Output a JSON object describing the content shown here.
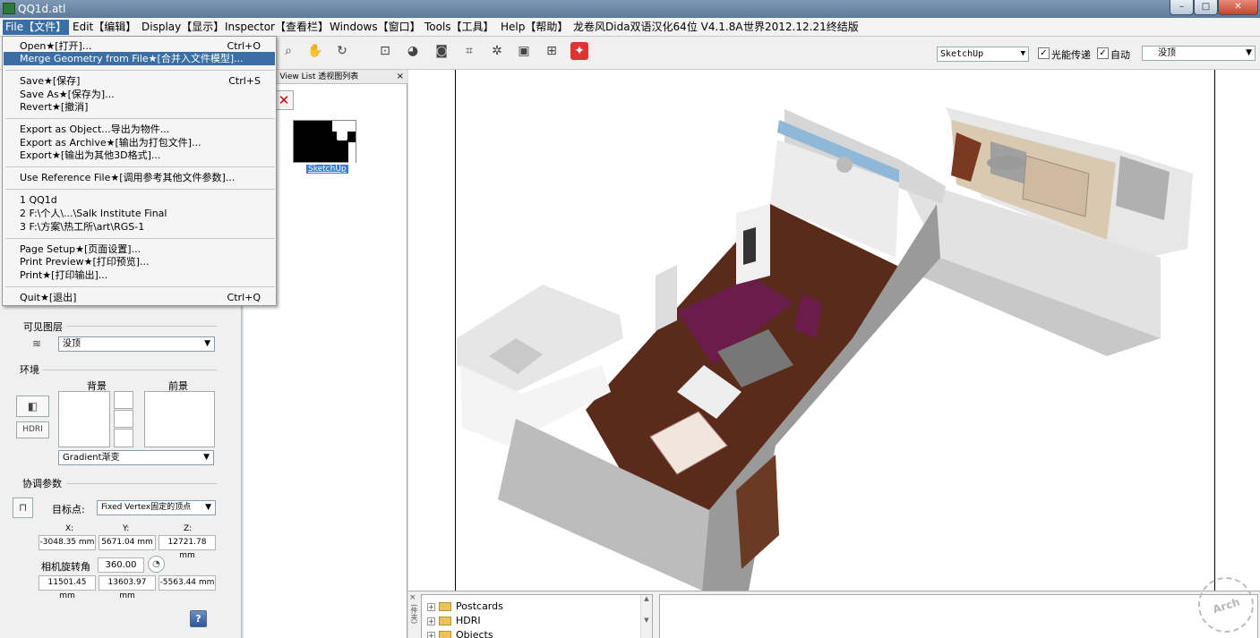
{
  "window": {
    "title": "QQ1d.atl",
    "minimize_glyph": "–",
    "maximize_glyph": "□",
    "close_glyph": "✕"
  },
  "menubar": [
    "File【文件】",
    "Edit【编辑】",
    "Display【显示】",
    "Inspector【查看栏】",
    "Windows【窗口】",
    "Tools【工具】",
    "Help【帮助】",
    "龙卷风Dida双语汉化64位 V4.1.8A",
    "世界2012.12.21终结版"
  ],
  "file_menu": {
    "items": [
      {
        "label": "Open★[打开]...",
        "shortcut": "Ctrl+O"
      },
      {
        "label": "Merge Geometry from File★[合并入文件模型]...",
        "shortcut": ""
      },
      {
        "label": "Save★[保存]",
        "shortcut": "Ctrl+S"
      },
      {
        "label": "Save As★[保存为]...",
        "shortcut": ""
      },
      {
        "label": "Revert★[撤消]",
        "shortcut": ""
      },
      {
        "label": "Export as Object...导出为物件...",
        "shortcut": ""
      },
      {
        "label": "Export as Archive★[输出为打包文件]...",
        "shortcut": ""
      },
      {
        "label": "Export★[输出为其他3D格式]...",
        "shortcut": ""
      },
      {
        "label": "Use Reference File★[调用参考其他文件参数]...",
        "shortcut": ""
      },
      {
        "label": "1 QQ1d",
        "shortcut": ""
      },
      {
        "label": "2 F:\\个人\\...\\Salk Institute Final",
        "shortcut": ""
      },
      {
        "label": "3 F:\\方案\\热工所\\art\\RGS-1",
        "shortcut": ""
      },
      {
        "label": "Page Setup★[页面设置]...",
        "shortcut": ""
      },
      {
        "label": "Print Preview★[打印预览]...",
        "shortcut": ""
      },
      {
        "label": "Print★[打印输出]...",
        "shortcut": ""
      },
      {
        "label": "Quit★[退出]",
        "shortcut": "Ctrl+Q"
      }
    ]
  },
  "toolbar": {
    "icons": [
      "crop-icon",
      "palette-icon",
      "camera-icon",
      "frame-icon",
      "gear-icon",
      "picture-icon",
      "add-view-icon",
      "render-icon"
    ],
    "pan_icons": [
      "zoom-icon",
      "hand-icon",
      "orbit-icon"
    ],
    "style_select": "SketchUp",
    "checkbox1_label": "光能传递",
    "checkbox1_checked": "✓",
    "checkbox2_label": "自动",
    "checkbox2_checked": "✓",
    "preset_select": "没顶"
  },
  "view_list": {
    "header": "e View List 透视图列表",
    "close_glyph": "×",
    "delete_glyph": "✕",
    "thumbnail_label": "SketchUp"
  },
  "left_panel": {
    "visible_layers_label": "可见图层",
    "layers_select": "没顶",
    "environment_label": "环境",
    "background_label": "背景",
    "foreground_label": "前景",
    "hdri_label": "HDRI",
    "gradient_select": "Gradient渐变",
    "camera_params_label": "协调参数",
    "target_label": "目标点:",
    "target_select": "Fixed Vertex固定的顶点",
    "x_label": "X:",
    "y_label": "Y:",
    "z_label": "Z:",
    "x_value": "-3048.35 mm",
    "y_value": "5671.04 mm",
    "z_value": "12721.78 mm",
    "rotation_label": "相机旋转角",
    "rotation_value": "360.00",
    "pos_x": "11501.45 mm",
    "pos_y": "13603.97 mm",
    "pos_z": "-5563.44 mm",
    "help_glyph": "?"
  },
  "bottom": {
    "side_tab": "(件夹)",
    "tree": [
      {
        "label": "Postcards"
      },
      {
        "label": "HDRI"
      },
      {
        "label": "Objects"
      }
    ]
  },
  "colors": {
    "menu_highlight": "#3a6ea5",
    "panel_bg": "#f0f0f0"
  }
}
